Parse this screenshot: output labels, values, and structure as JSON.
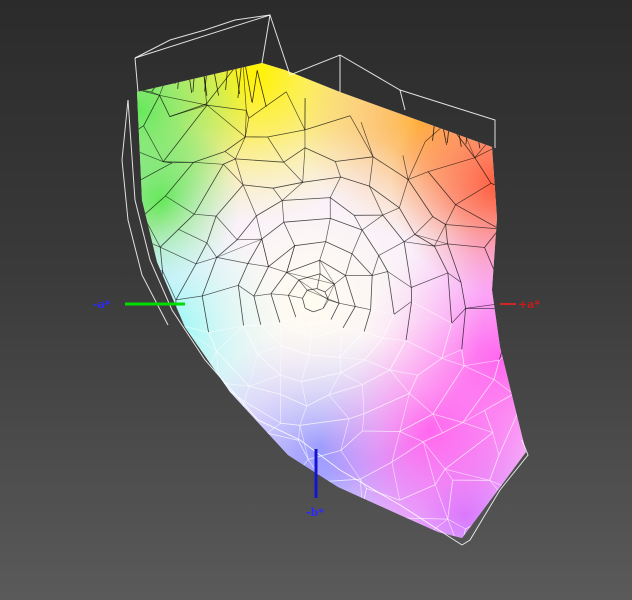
{
  "axes": {
    "neg_a": {
      "label": "-a*",
      "line_color": "#00dd00",
      "text_color": "#2a2aff"
    },
    "pos_a": {
      "label": "+a*",
      "line_color": "#ff2020",
      "text_color": "#cc1a1a"
    },
    "neg_b": {
      "label": "-b*",
      "line_color": "#1515d0",
      "text_color": "#2a2aff"
    }
  },
  "colors": {
    "background_top": "#2b2b2b",
    "background_bottom": "#5a5a5a",
    "wireframe_outer": "#ffffff",
    "wireframe_inner": "#000000",
    "gamut_white": "#fffde8",
    "gamut_yellow": "#fff200",
    "gamut_green": "#66e85a",
    "gamut_cyan": "#7ff7f7",
    "gamut_blue": "#8a8aff",
    "gamut_violet": "#d37bff",
    "gamut_magenta": "#ff66ee",
    "gamut_red": "#ff5a3a",
    "gamut_orange": "#ffb33a"
  }
}
